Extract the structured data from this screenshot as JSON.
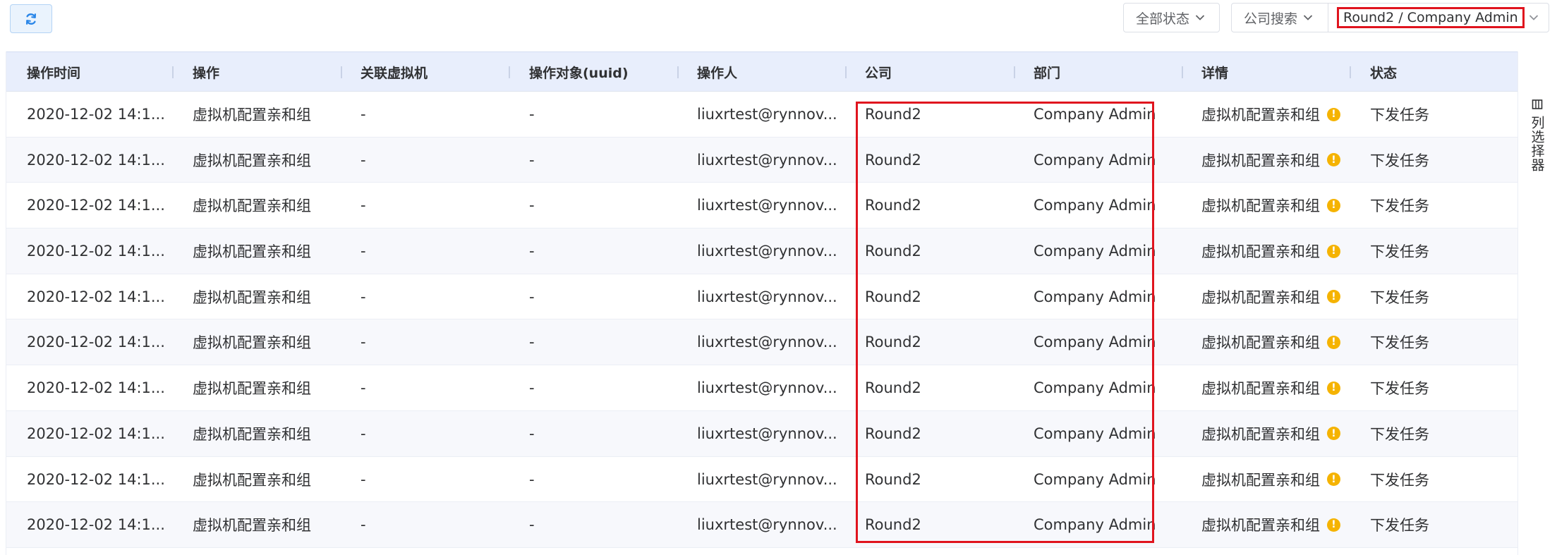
{
  "toolbar": {
    "status_filter": "全部状态",
    "company_filter": "公司搜索",
    "dept_filter": "Round2 / Company Admin"
  },
  "columns": [
    "操作时间",
    "操作",
    "关联虚拟机",
    "操作对象(uuid)",
    "操作人",
    "公司",
    "部门",
    "详情",
    "状态"
  ],
  "rows": [
    {
      "time": "2020-12-02 14:1...",
      "op": "虚拟机配置亲和组",
      "vm": "-",
      "uuid": "-",
      "operator": "liuxrtest@rynnov...",
      "company": "Round2",
      "dept": "Company Admin",
      "detail": "虚拟机配置亲和组",
      "status": "下发任务"
    },
    {
      "time": "2020-12-02 14:1...",
      "op": "虚拟机配置亲和组",
      "vm": "-",
      "uuid": "-",
      "operator": "liuxrtest@rynnov...",
      "company": "Round2",
      "dept": "Company Admin",
      "detail": "虚拟机配置亲和组",
      "status": "下发任务"
    },
    {
      "time": "2020-12-02 14:1...",
      "op": "虚拟机配置亲和组",
      "vm": "-",
      "uuid": "-",
      "operator": "liuxrtest@rynnov...",
      "company": "Round2",
      "dept": "Company Admin",
      "detail": "虚拟机配置亲和组",
      "status": "下发任务"
    },
    {
      "time": "2020-12-02 14:1...",
      "op": "虚拟机配置亲和组",
      "vm": "-",
      "uuid": "-",
      "operator": "liuxrtest@rynnov...",
      "company": "Round2",
      "dept": "Company Admin",
      "detail": "虚拟机配置亲和组",
      "status": "下发任务"
    },
    {
      "time": "2020-12-02 14:1...",
      "op": "虚拟机配置亲和组",
      "vm": "-",
      "uuid": "-",
      "operator": "liuxrtest@rynnov...",
      "company": "Round2",
      "dept": "Company Admin",
      "detail": "虚拟机配置亲和组",
      "status": "下发任务"
    },
    {
      "time": "2020-12-02 14:1...",
      "op": "虚拟机配置亲和组",
      "vm": "-",
      "uuid": "-",
      "operator": "liuxrtest@rynnov...",
      "company": "Round2",
      "dept": "Company Admin",
      "detail": "虚拟机配置亲和组",
      "status": "下发任务"
    },
    {
      "time": "2020-12-02 14:1...",
      "op": "虚拟机配置亲和组",
      "vm": "-",
      "uuid": "-",
      "operator": "liuxrtest@rynnov...",
      "company": "Round2",
      "dept": "Company Admin",
      "detail": "虚拟机配置亲和组",
      "status": "下发任务"
    },
    {
      "time": "2020-12-02 14:1...",
      "op": "虚拟机配置亲和组",
      "vm": "-",
      "uuid": "-",
      "operator": "liuxrtest@rynnov...",
      "company": "Round2",
      "dept": "Company Admin",
      "detail": "虚拟机配置亲和组",
      "status": "下发任务"
    },
    {
      "time": "2020-12-02 14:1...",
      "op": "虚拟机配置亲和组",
      "vm": "-",
      "uuid": "-",
      "operator": "liuxrtest@rynnov...",
      "company": "Round2",
      "dept": "Company Admin",
      "detail": "虚拟机配置亲和组",
      "status": "下发任务"
    },
    {
      "time": "2020-12-02 14:1...",
      "op": "虚拟机配置亲和组",
      "vm": "-",
      "uuid": "-",
      "operator": "liuxrtest@rynnov...",
      "company": "Round2",
      "dept": "Company Admin",
      "detail": "虚拟机配置亲和组",
      "status": "下发任务"
    }
  ],
  "column_picker": {
    "label": "列选择器",
    "icon": "columns-icon"
  },
  "icons": {
    "refresh": "refresh-icon",
    "dropdown": "chevron-down-icon",
    "detail": "warning-icon"
  },
  "colors": {
    "highlight": "#e0141e",
    "warning": "#f5b301",
    "header_bg": "#e8eefc",
    "primary": "#2a86e8"
  }
}
